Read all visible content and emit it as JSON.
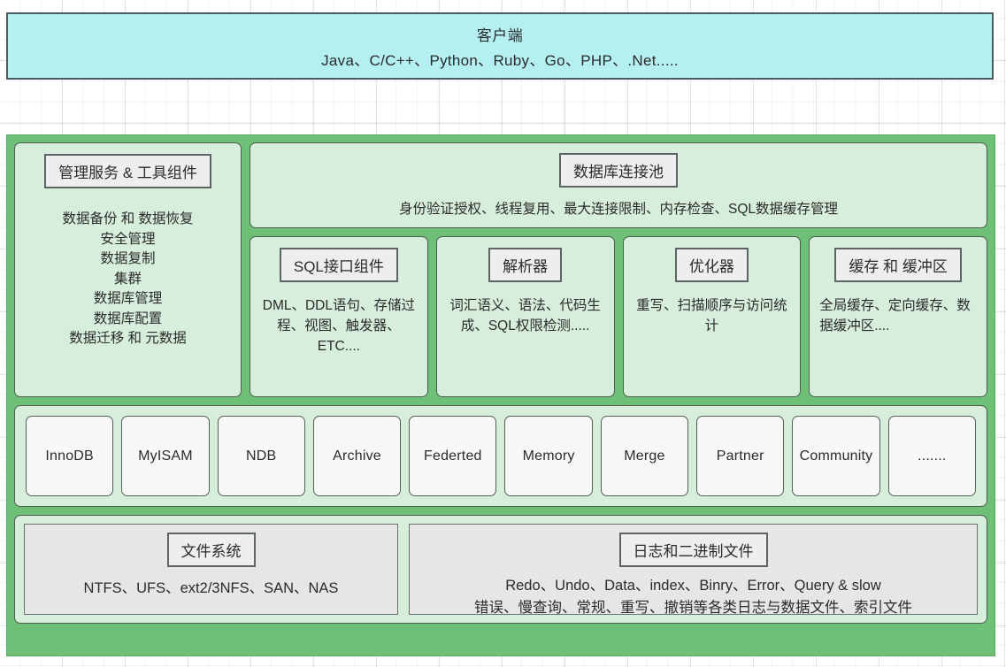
{
  "client": {
    "title": "客户端",
    "languages": "Java、C/C++、Python、Ruby、Go、PHP、.Net....."
  },
  "management": {
    "title": "管理服务 & 工具组件",
    "lines": [
      "数据备份 和 数据恢复",
      "安全管理",
      "数据复制",
      "集群",
      "数据库管理",
      "数据库配置",
      "数据迁移 和 元数据"
    ]
  },
  "connection_pool": {
    "title": "数据库连接池",
    "description": "身份验证授权、线程复用、最大连接限制、内存检查、SQL数据缓存管理"
  },
  "components": [
    {
      "title": "SQL接口组件",
      "description": "DML、DDL语句、存储过程、视图、触发器、ETC....",
      "align": "center"
    },
    {
      "title": "解析器",
      "description": "词汇语义、语法、代码生成、SQL权限检测.....",
      "align": "center"
    },
    {
      "title": "优化器",
      "description": "重写、扫描顺序与访问统计",
      "align": "center"
    },
    {
      "title": "缓存 和 缓冲区",
      "description": "全局缓存、定向缓存、数据缓冲区....",
      "align": "left"
    }
  ],
  "storage_engines": [
    "InnoDB",
    "MyISAM",
    "NDB",
    "Archive",
    "Federted",
    "Memory",
    "Merge",
    "Partner",
    "Community",
    "......."
  ],
  "file_system": {
    "title": "文件系统",
    "description": "NTFS、UFS、ext2/3NFS、SAN、NAS"
  },
  "log_files": {
    "title": "日志和二进制文件",
    "line1": "Redo、Undo、Data、index、Binry、Error、Query & slow",
    "line2": "错误、慢查询、常规、重写、撤销等各类日志与数据文件、索引文件"
  },
  "colors": {
    "client_fill": "#b4eff1",
    "server_green": "#6fc077",
    "panel_fill": "#d6eedb",
    "chip_fill": "#eeeeee",
    "engine_fill": "#f7f7f7",
    "gray_fill": "#e6e6e6"
  }
}
